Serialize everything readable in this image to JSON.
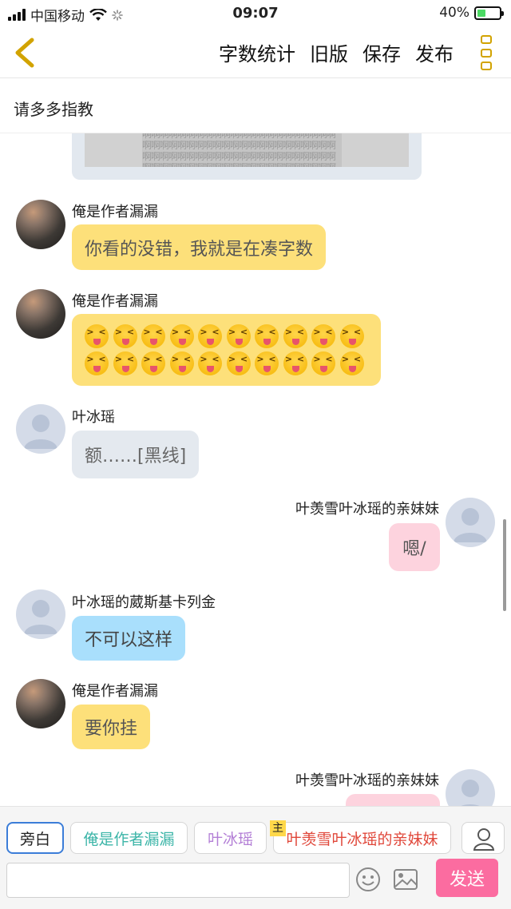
{
  "status_bar": {
    "carrier": "中国移动",
    "time": "09:07",
    "battery": "40%",
    "battery_level": 0.4
  },
  "nav": {
    "actions": [
      "字数统计",
      "旧版",
      "保存",
      "发布"
    ]
  },
  "subtitle": "请多多指教",
  "image_card": {
    "repeated_char": "啊"
  },
  "messages": [
    {
      "name": "俺是作者漏漏",
      "text": "你看的没错，我就是在凑字数",
      "side": "left"
    },
    {
      "name": "俺是作者漏漏",
      "emoji": "squinting-tongue-face",
      "emoji_count": 20,
      "side": "left"
    },
    {
      "name": "叶冰瑶",
      "text": "额……[黑线]",
      "side": "left"
    },
    {
      "name": "叶羡雪叶冰瑶的亲妹妹",
      "text": "嗯/",
      "side": "right"
    },
    {
      "name": "叶冰瑶的葳斯基卡列金",
      "text": "不可以这样",
      "side": "left"
    },
    {
      "name": "俺是作者漏漏",
      "text": "要你挂",
      "side": "left"
    },
    {
      "name": "叶羡雪叶冰瑶的亲妹妹",
      "text": "",
      "side": "right"
    }
  ],
  "roles": {
    "narration": "旁白",
    "author": "俺是作者漏漏",
    "bingyao": "叶冰瑶",
    "host_tag": "主",
    "sister": "叶羡雪叶冰瑶的亲妹妹",
    "colors": {
      "narration": "#222222",
      "author": "#3cb5a8",
      "bingyao": "#b37fd6",
      "sister": "#e0473a"
    }
  },
  "input": {
    "value": "",
    "placeholder": "",
    "send_label": "发送"
  },
  "colors": {
    "yellow_bubble": "#fde07a",
    "pink_bubble": "#fdd3de",
    "blue_bubble": "#a9dffc",
    "grey_bubble": "#e4e9ef",
    "send_button": "#fb6ca0",
    "accent": "#d2a300"
  }
}
